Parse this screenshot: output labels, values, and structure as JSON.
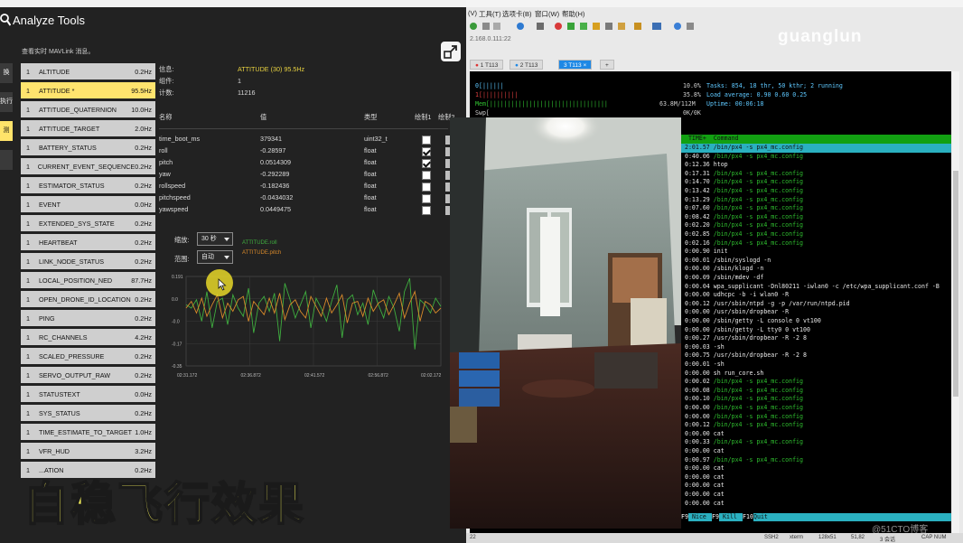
{
  "analyze": {
    "title": "Analyze Tools",
    "subtitle": "查看实时 MAVLink 消息。",
    "rail": [
      "换",
      "执行",
      "测"
    ],
    "messages": [
      {
        "count": "1",
        "name": "ALTITUDE",
        "rate": "0.2Hz"
      },
      {
        "count": "1",
        "name": "ATTITUDE *",
        "rate": "95.5Hz",
        "selected": true
      },
      {
        "count": "1",
        "name": "ATTITUDE_QUATERNION",
        "rate": "10.0Hz"
      },
      {
        "count": "1",
        "name": "ATTITUDE_TARGET",
        "rate": "2.0Hz"
      },
      {
        "count": "1",
        "name": "BATTERY_STATUS",
        "rate": "0.2Hz"
      },
      {
        "count": "1",
        "name": "CURRENT_EVENT_SEQUENCE",
        "rate": "0.2Hz"
      },
      {
        "count": "1",
        "name": "ESTIMATOR_STATUS",
        "rate": "0.2Hz"
      },
      {
        "count": "1",
        "name": "EVENT",
        "rate": "0.0Hz"
      },
      {
        "count": "1",
        "name": "EXTENDED_SYS_STATE",
        "rate": "0.2Hz"
      },
      {
        "count": "1",
        "name": "HEARTBEAT",
        "rate": "0.2Hz"
      },
      {
        "count": "1",
        "name": "LINK_NODE_STATUS",
        "rate": "0.2Hz"
      },
      {
        "count": "1",
        "name": "LOCAL_POSITION_NED",
        "rate": "87.7Hz"
      },
      {
        "count": "1",
        "name": "OPEN_DRONE_ID_LOCATION",
        "rate": "0.2Hz"
      },
      {
        "count": "1",
        "name": "PING",
        "rate": "0.2Hz"
      },
      {
        "count": "1",
        "name": "RC_CHANNELS",
        "rate": "4.2Hz"
      },
      {
        "count": "1",
        "name": "SCALED_PRESSURE",
        "rate": "0.2Hz"
      },
      {
        "count": "1",
        "name": "SERVO_OUTPUT_RAW",
        "rate": "0.2Hz"
      },
      {
        "count": "1",
        "name": "STATUSTEXT",
        "rate": "0.0Hz"
      },
      {
        "count": "1",
        "name": "SYS_STATUS",
        "rate": "0.2Hz"
      },
      {
        "count": "1",
        "name": "TIME_ESTIMATE_TO_TARGET",
        "rate": "1.0Hz"
      },
      {
        "count": "1",
        "name": "VFR_HUD",
        "rate": "3.2Hz"
      },
      {
        "count": "1",
        "name": "...ATION",
        "rate": "0.2Hz"
      }
    ],
    "info": {
      "message_label": "信息:",
      "message_value": "ATTITUDE (30) 95.5Hz",
      "component_label": "组件:",
      "component_value": "1",
      "count_label": "计数:",
      "count_value": "11216"
    },
    "table_headers": {
      "name": "名称",
      "value": "值",
      "type": "类型",
      "plot1": "绘制1",
      "plot2": "绘制2"
    },
    "fields": [
      {
        "name": "time_boot_ms",
        "value": "379341",
        "type": "uint32_t",
        "plot1": false
      },
      {
        "name": "roll",
        "value": "-0.28597",
        "type": "float",
        "plot1": true
      },
      {
        "name": "pitch",
        "value": "0.0514309",
        "type": "float",
        "plot1": true
      },
      {
        "name": "yaw",
        "value": "-0.292289",
        "type": "float",
        "plot1": false
      },
      {
        "name": "rollspeed",
        "value": "-0.182436",
        "type": "float",
        "plot1": false
      },
      {
        "name": "pitchspeed",
        "value": "-0.0434032",
        "type": "float",
        "plot1": false
      },
      {
        "name": "yawspeed",
        "value": "0.0449475",
        "type": "float",
        "plot1": false
      }
    ],
    "scale_label": "缩放:",
    "scale_value": "30 秒",
    "range_label": "范围:",
    "range_value": "自动",
    "legend": [
      {
        "name": "ATTITUDE.roll",
        "color": "#3fae3f"
      },
      {
        "name": "ATTITUDE.pitch",
        "color": "#d98a2a"
      }
    ]
  },
  "chart_data": {
    "type": "line",
    "y_ticks": [
      "0.191",
      "0.0",
      "-0.0",
      "-0.17",
      "-0.35"
    ],
    "x_ticks": [
      "02:31.172",
      "02:36.872",
      "02:41.572",
      "02:56.872",
      "02:02.172"
    ],
    "ylim": [
      -0.35,
      0.191
    ],
    "series": [
      {
        "name": "ATTITUDE.roll",
        "color": "#3fae3f",
        "values": [
          0.02,
          0.0,
          0.05,
          -0.08,
          0.1,
          -0.12,
          0.04,
          0.06,
          -0.1,
          0.08,
          0.0,
          -0.05,
          0.12,
          -0.15,
          0.03,
          0.07,
          -0.02,
          0.09,
          -0.2,
          0.15,
          0.05,
          -0.06,
          0.02,
          0.1,
          -0.12,
          0.06,
          0.0,
          -0.08,
          0.04,
          0.14,
          -0.18,
          0.05,
          0.08,
          -0.04,
          0.03,
          -0.1,
          0.11,
          0.02,
          -0.06,
          0.07,
          0.0,
          -0.14,
          0.1,
          0.18,
          -0.25,
          0.05,
          0.02,
          -0.03,
          0.06,
          0.01
        ]
      },
      {
        "name": "ATTITUDE.pitch",
        "color": "#d98a2a",
        "values": [
          0.0,
          0.04,
          -0.03,
          0.06,
          -0.05,
          0.02,
          0.08,
          -0.06,
          0.03,
          -0.02,
          0.05,
          0.07,
          -0.08,
          0.04,
          0.0,
          -0.04,
          0.06,
          -0.03,
          0.09,
          -0.07,
          0.02,
          0.05,
          -0.02,
          -0.06,
          0.07,
          0.01,
          -0.05,
          0.06,
          -0.03,
          0.02,
          0.08,
          -0.09,
          0.03,
          0.04,
          -0.05,
          0.06,
          -0.02,
          0.03,
          0.05,
          -0.04,
          0.02,
          0.09,
          -0.06,
          0.03,
          0.1,
          -0.08,
          0.04,
          0.02,
          -0.03,
          0.0
        ]
      }
    ]
  },
  "terminal": {
    "menu": [
      "(V)",
      "工具(T)",
      "选项卡(B)",
      "窗口(W)",
      "帮助(H)"
    ],
    "address": "2.168.0.111:22",
    "watermark": "guanglun",
    "tabs": [
      "1 T113",
      "2 T113",
      "3 T113"
    ],
    "htop": {
      "cpu0": "0[||||||",
      "cpu0_pct": "10.0%",
      "cpu1": "1[||||||||||",
      "cpu1_pct": "35.8%",
      "mem": "Mem[|||||||||||||||||||||||||||||||||",
      "mem_val": "63.8M/112M",
      "swp": "Swp[",
      "swp_val": "0K/0K",
      "tasks": "Tasks: 854, 18 thr, 50 kthr; 2 running",
      "load": "Load average: 0.90 0.60 0.25",
      "uptime": "Uptime: 00:06:18"
    },
    "proc_header": "  TIME+  Command",
    "procs": [
      {
        "t": " 2:01.57",
        "c": "/bin/px4 -s px4_mc.config",
        "sel": true
      },
      {
        "t": " 0:40.06",
        "c": "/bin/px4 -s px4_mc.config",
        "green": true
      },
      {
        "t": " 0:12.36",
        "c": "htop"
      },
      {
        "t": " 0:17.31",
        "c": "/bin/px4 -s px4_mc.config",
        "green": true
      },
      {
        "t": " 0:14.70",
        "c": "/bin/px4 -s px4_mc.config",
        "green": true
      },
      {
        "t": " 0:13.42",
        "c": "/bin/px4 -s px4_mc.config",
        "green": true
      },
      {
        "t": " 0:13.29",
        "c": "/bin/px4 -s px4_mc.config",
        "green": true
      },
      {
        "t": " 0:07.60",
        "c": "/bin/px4 -s px4_mc.config",
        "green": true
      },
      {
        "t": " 0:08.42",
        "c": "/bin/px4 -s px4_mc.config",
        "green": true
      },
      {
        "t": " 0:02.20",
        "c": "/bin/px4 -s px4_mc.config",
        "green": true
      },
      {
        "t": " 0:02.85",
        "c": "/bin/px4 -s px4_mc.config",
        "green": true
      },
      {
        "t": " 0:02.16",
        "c": "/bin/px4 -s px4_mc.config",
        "green": true
      },
      {
        "t": " 0:00.90",
        "c": "init"
      },
      {
        "t": " 0:00.01",
        "c": "/sbin/syslogd -n"
      },
      {
        "t": " 0:00.00",
        "c": "/sbin/klogd -n"
      },
      {
        "t": " 0:00.09",
        "c": "/sbin/mdev -df"
      },
      {
        "t": " 0:00.04",
        "c": "wpa_supplicant -Dnl80211 -iwlan0 -c /etc/wpa_supplicant.conf -B"
      },
      {
        "t": " 0:00.00",
        "c": "udhcpc -b -i wlan0 -R"
      },
      {
        "t": " 0:00.12",
        "c": "/usr/sbin/ntpd -g -p /var/run/ntpd.pid"
      },
      {
        "t": " 0:00.00",
        "c": "/usr/sbin/dropbear -R"
      },
      {
        "t": " 0:00.00",
        "c": "/sbin/getty -L console 0 vt100"
      },
      {
        "t": " 0:00.00",
        "c": "/sbin/getty -L tty0 0 vt100"
      },
      {
        "t": " 0:00.27",
        "c": "/usr/sbin/dropbear -R -2 8"
      },
      {
        "t": " 0:00.03",
        "c": "-sh"
      },
      {
        "t": " 0:00.75",
        "c": "/usr/sbin/dropbear -R -2 8"
      },
      {
        "t": " 0:00.01",
        "c": "-sh"
      },
      {
        "t": " 0:00.00",
        "c": "sh run_core.sh"
      },
      {
        "t": " 0:00.02",
        "c": "/bin/px4 -s px4_mc.config",
        "green": true
      },
      {
        "t": " 0:00.08",
        "c": "/bin/px4 -s px4_mc.config",
        "green": true
      },
      {
        "t": " 0:00.10",
        "c": "/bin/px4 -s px4_mc.config",
        "green": true
      },
      {
        "t": " 0:00.00",
        "c": "/bin/px4 -s px4_mc.config",
        "green": true
      },
      {
        "t": " 0:00.00",
        "c": "/bin/px4 -s px4_mc.config",
        "green": true
      },
      {
        "t": " 0:00.12",
        "c": "/bin/px4 -s px4_mc.config",
        "green": true
      },
      {
        "t": " 0:00.00",
        "c": "cat"
      },
      {
        "t": " 0:00.33",
        "c": "/bin/px4 -s px4_mc.config",
        "green": true
      },
      {
        "t": " 0:00.00",
        "c": "cat"
      },
      {
        "t": " 0:00.97",
        "c": "/bin/px4 -s px4_mc.config",
        "green": true
      },
      {
        "t": " 0:00.00",
        "c": "cat"
      },
      {
        "t": " 0:00.00",
        "c": "cat"
      },
      {
        "t": " 0:00.00",
        "c": "cat"
      },
      {
        "t": " 0:00.00",
        "c": "cat"
      },
      {
        "t": " 0:00.00",
        "c": "cat"
      }
    ],
    "fkeys": [
      {
        "key": "F9",
        "label": "Nice "
      },
      {
        "key": "F9",
        "label": "Kill "
      },
      {
        "key": "F10",
        "label": "Quit"
      }
    ],
    "status": {
      "left": "22",
      "ssh": "SSH2",
      "xterm": "xterm",
      "size": "128x51",
      "pos": "51,82",
      "sessions": "3 会话",
      "caps": "CAP NUM"
    }
  },
  "overlay": {
    "subtitle": "自稳飞行效果",
    "watermark": "@51CTO博客"
  }
}
